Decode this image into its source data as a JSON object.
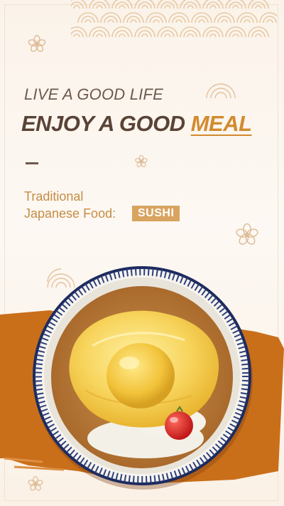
{
  "headline": {
    "line1": "LIVE A GOOD LIFE",
    "line2_prefix": "ENJOY A GOOD ",
    "line2_accent": "MEAL"
  },
  "subtitle": {
    "line1": "Traditional",
    "line2": "Japanese Food:",
    "badge": "SUSHI"
  },
  "colors": {
    "background": "#fbf3ea",
    "heading": "#5a4336",
    "accent": "#d38a2f",
    "subtitle": "#c58d45",
    "badge_bg": "#d9a45f",
    "brush": "#c96f1a",
    "bowl_rim": "#2d3e7a"
  },
  "decorations": {
    "top_pattern": "seigaiha-wave-pattern",
    "flower_icons": "sakura-outline-icon",
    "dish": "omurice-curry-bowl"
  }
}
